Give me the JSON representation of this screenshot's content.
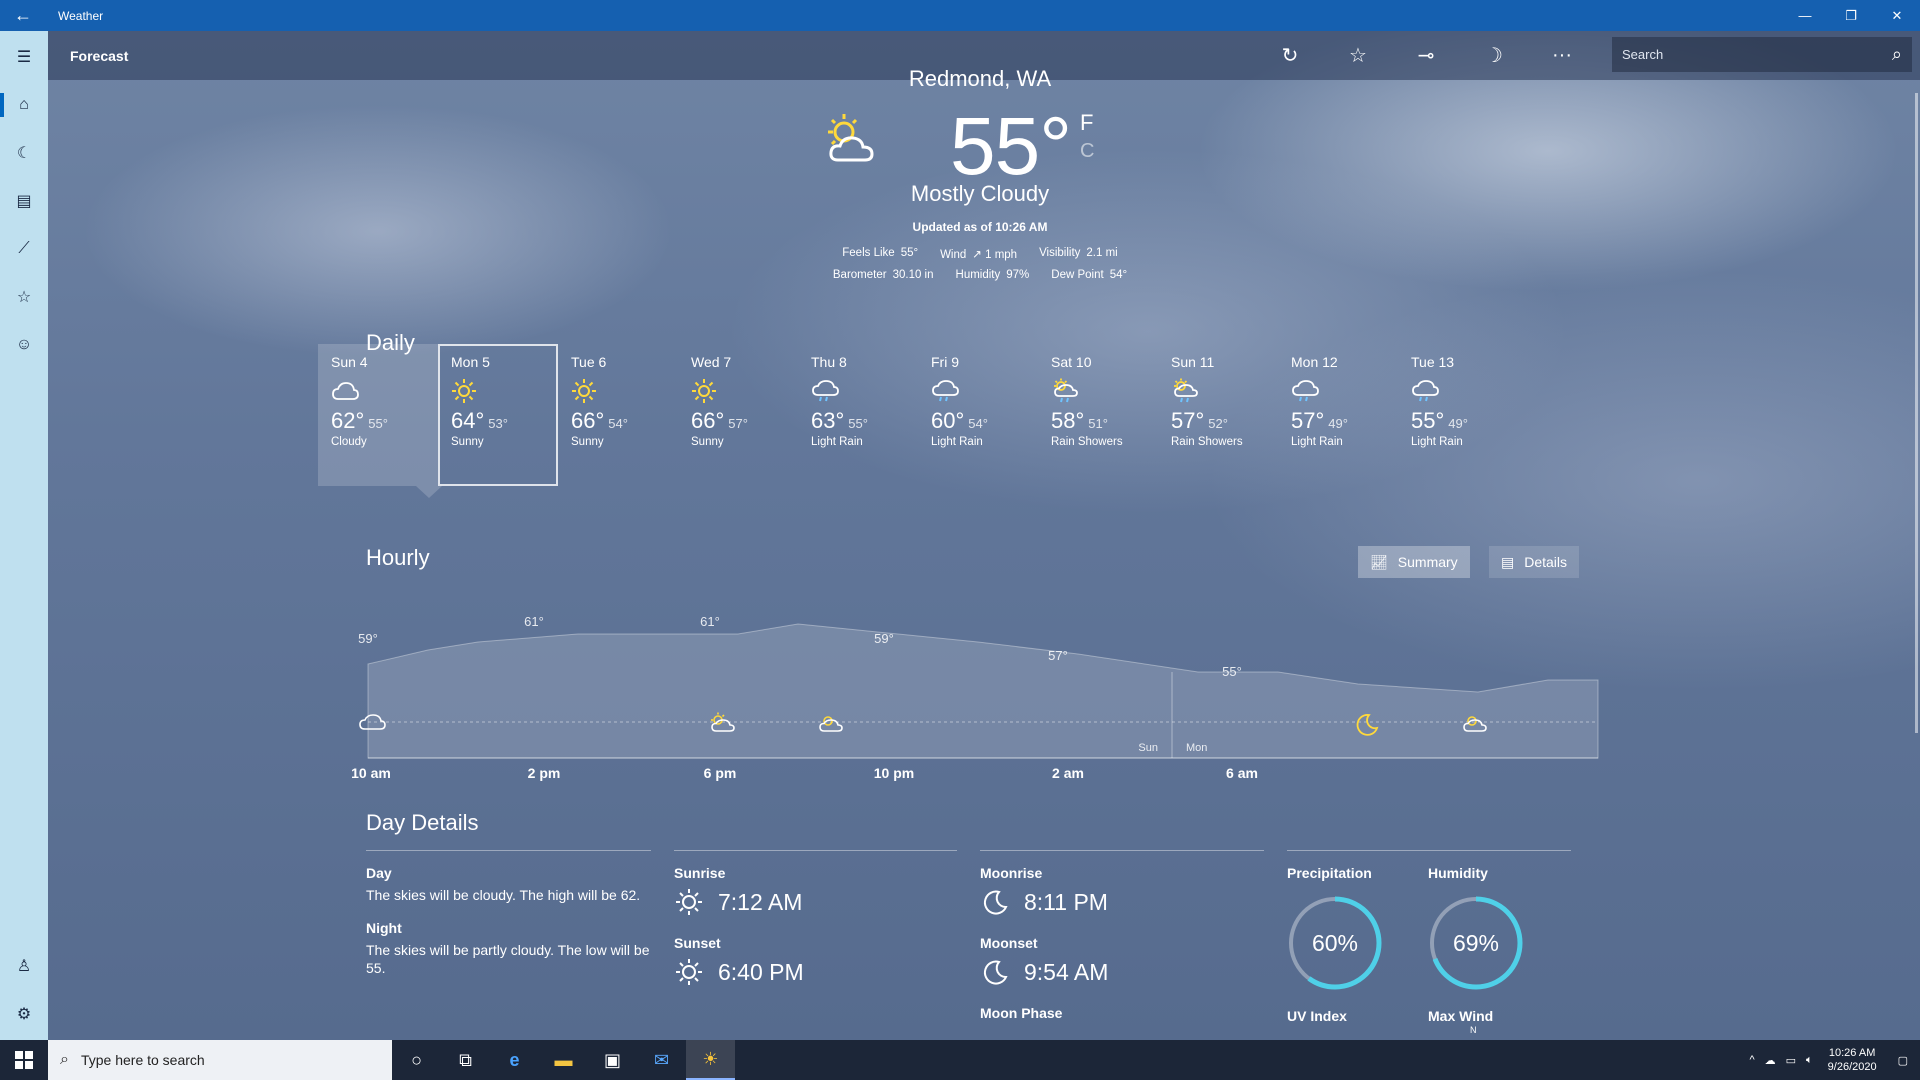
{
  "window": {
    "app_title": "Weather",
    "back_glyph": "←",
    "minimize_glyph": "—",
    "restore_glyph": "❐",
    "close_glyph": "✕"
  },
  "rail": {
    "menu": "☰",
    "home": "⌂",
    "maps": "☾",
    "news": "▤",
    "historical": "⟋",
    "favorites": "☆",
    "feedback": "☺",
    "account": "♙",
    "settings": "⚙"
  },
  "header": {
    "title": "Forecast",
    "refresh": "↻",
    "favorite": "☆",
    "pin": "⊸",
    "theme": "☽",
    "more": "···",
    "search_placeholder": "Search",
    "search_icon": "⌕"
  },
  "current": {
    "location": "Redmond, WA",
    "temp": "55°",
    "unit_f": "F",
    "unit_c": "C",
    "condition": "Mostly Cloudy",
    "updated": "Updated as of 10:26 AM",
    "icon": "partly-sunny-icon",
    "stats": [
      [
        {
          "label": "Feels Like",
          "value": "55°"
        },
        {
          "label": "Wind",
          "value": "↗ 1 mph"
        },
        {
          "label": "Visibility",
          "value": "2.1 mi"
        }
      ],
      [
        {
          "label": "Barometer",
          "value": "30.10 in"
        },
        {
          "label": "Humidity",
          "value": "97%"
        },
        {
          "label": "Dew Point",
          "value": "54°"
        }
      ]
    ]
  },
  "daily": {
    "title": "Daily",
    "days": [
      {
        "name": "Sun 4",
        "hi": "62°",
        "lo": "55°",
        "desc": "Cloudy",
        "icon": "cloud"
      },
      {
        "name": "Mon 5",
        "hi": "64°",
        "lo": "53°",
        "desc": "Sunny",
        "icon": "sun"
      },
      {
        "name": "Tue 6",
        "hi": "66°",
        "lo": "54°",
        "desc": "Sunny",
        "icon": "sun"
      },
      {
        "name": "Wed 7",
        "hi": "66°",
        "lo": "57°",
        "desc": "Sunny",
        "icon": "sun"
      },
      {
        "name": "Thu 8",
        "hi": "63°",
        "lo": "55°",
        "desc": "Light Rain",
        "icon": "rain"
      },
      {
        "name": "Fri 9",
        "hi": "60°",
        "lo": "54°",
        "desc": "Light Rain",
        "icon": "rain"
      },
      {
        "name": "Sat 10",
        "hi": "58°",
        "lo": "51°",
        "desc": "Rain Showers",
        "icon": "sunrain"
      },
      {
        "name": "Sun 11",
        "hi": "57°",
        "lo": "52°",
        "desc": "Rain Showers",
        "icon": "sunrain"
      },
      {
        "name": "Mon 12",
        "hi": "57°",
        "lo": "49°",
        "desc": "Light Rain",
        "icon": "rain"
      },
      {
        "name": "Tue 13",
        "hi": "55°",
        "lo": "49°",
        "desc": "Light Rain",
        "icon": "rain"
      }
    ]
  },
  "hourly": {
    "title": "Hourly",
    "summary_label": "Summary",
    "details_label": "Details",
    "temp_labels": [
      "59°",
      "61°",
      "61°",
      "59°",
      "57°",
      "55°"
    ],
    "time_labels": [
      "10 am",
      "2 pm",
      "6 pm",
      "10 pm",
      "2 am",
      "6 am"
    ],
    "day_left": "Sun",
    "day_right": "Mon",
    "icons": [
      "cloud",
      "partly-sunny",
      "partly-cloudy",
      "moon",
      "partly-cloudy"
    ]
  },
  "details": {
    "title": "Day Details",
    "day_label": "Day",
    "day_text": "The skies will be cloudy. The high will be 62.",
    "night_label": "Night",
    "night_text": "The skies will be partly cloudy. The low will be 55.",
    "sunrise_label": "Sunrise",
    "sunrise": "7:12 AM",
    "sunset_label": "Sunset",
    "sunset": "6:40 PM",
    "moonrise_label": "Moonrise",
    "moonrise": "8:11 PM",
    "moonset_label": "Moonset",
    "moonset": "9:54 AM",
    "moonphase_label": "Moon Phase",
    "precip_label": "Precipitation",
    "precip": "60%",
    "precip_value": 0.6,
    "humidity_label": "Humidity",
    "humidity": "69%",
    "humidity_value": 0.69,
    "uv_label": "UV Index",
    "wind_label": "Max Wind",
    "wind_dir": "N"
  },
  "taskbar": {
    "search_placeholder": "Type here to search",
    "time": "10:26 AM",
    "date": "9/26/2020"
  },
  "colors": {
    "accent": "#4fd0e8",
    "titlebar": "#1560b0",
    "rail": "#bfe0ef"
  }
}
